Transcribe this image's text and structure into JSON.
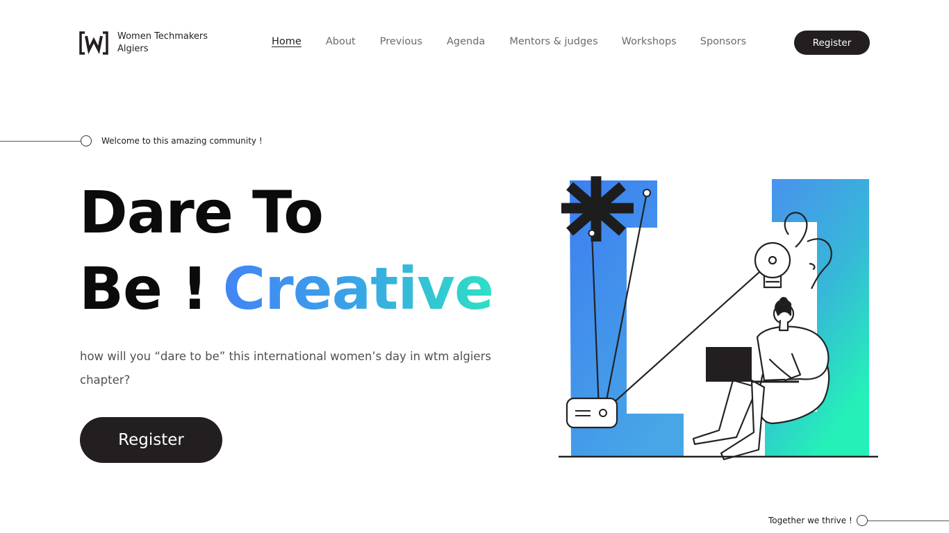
{
  "header": {
    "logo": {
      "line1": "Women Techmakers",
      "line2": "Algiers"
    },
    "nav": [
      {
        "label": "Home",
        "active": true
      },
      {
        "label": "About",
        "active": false
      },
      {
        "label": "Previous",
        "active": false
      },
      {
        "label": "Agenda",
        "active": false
      },
      {
        "label": "Mentors & judges",
        "active": false
      },
      {
        "label": "Workshops",
        "active": false
      },
      {
        "label": "Sponsors",
        "active": false
      }
    ],
    "register_label": "Register"
  },
  "hero": {
    "welcome": "Welcome to this amazing community !",
    "title_line1": "Dare To",
    "title_line2_prefix": "Be !",
    "title_highlight": "Creative",
    "subtitle": "how will you “dare to be” this international women’s day in wtm algiers chapter?",
    "register_label": "Register"
  },
  "footer": {
    "together": "Together we thrive !"
  },
  "colors": {
    "dark": "#231f20",
    "gradient_start": "#4285f4",
    "gradient_end": "#2ee0c5"
  },
  "icons": {
    "logo": "wtm-bracket-w-logo",
    "illustration": "woman-with-laptop-and-lightbulb-illustration"
  }
}
